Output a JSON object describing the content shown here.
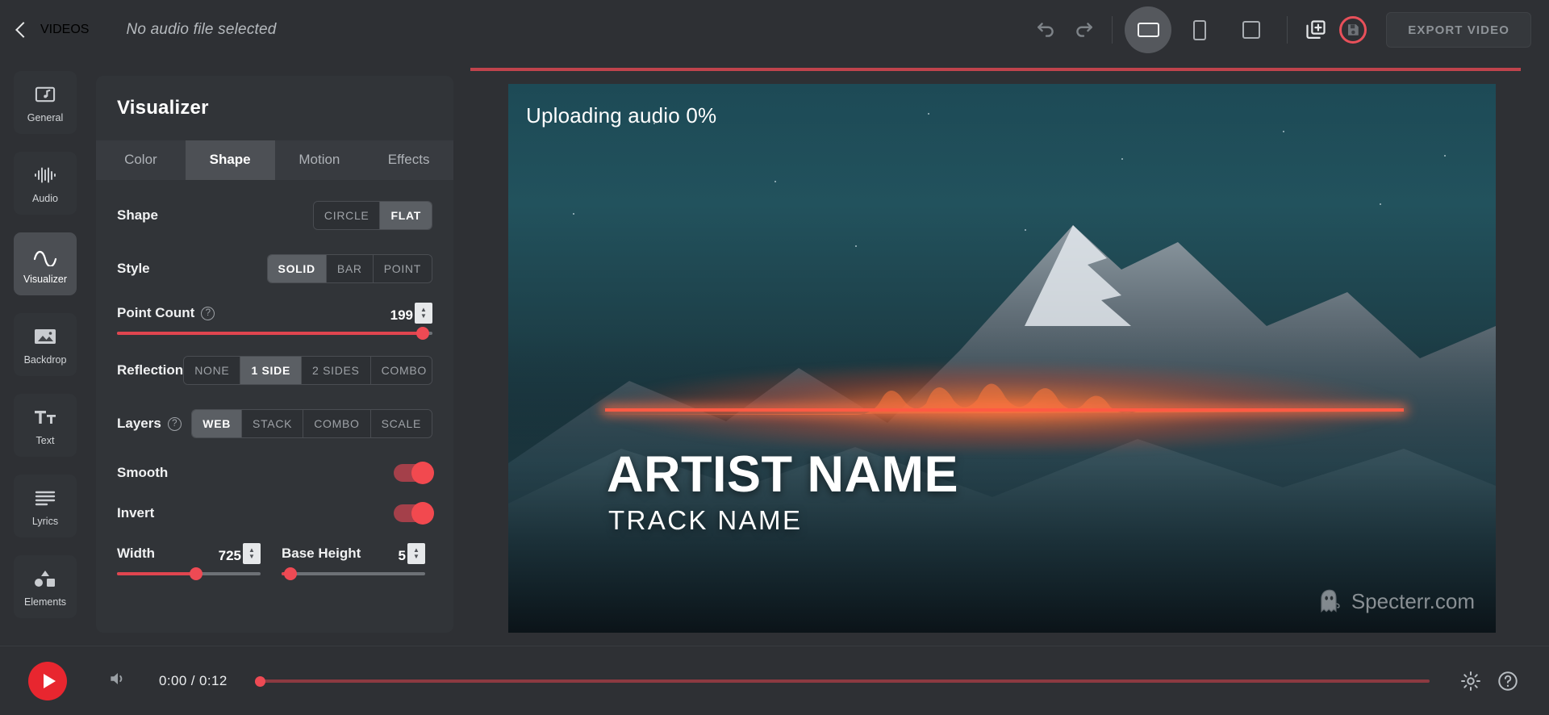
{
  "topbar": {
    "back_label": "VIDEOS",
    "audio_status": "No audio file selected",
    "undo_icon": "undo-icon",
    "redo_icon": "redo-icon",
    "ratios": [
      {
        "name": "landscape",
        "selected": true
      },
      {
        "name": "portrait",
        "selected": false
      },
      {
        "name": "square",
        "selected": false
      }
    ],
    "add_scene_icon": "add-scene-icon",
    "record_icon": "record-icon",
    "export_label": "EXPORT VIDEO"
  },
  "sidebar": {
    "items": [
      {
        "label": "General",
        "icon": "general-icon",
        "active": false
      },
      {
        "label": "Audio",
        "icon": "audio-waveform-icon",
        "active": false
      },
      {
        "label": "Visualizer",
        "icon": "sine-wave-icon",
        "active": true
      },
      {
        "label": "Backdrop",
        "icon": "image-icon",
        "active": false
      },
      {
        "label": "Text",
        "icon": "text-icon",
        "active": false
      },
      {
        "label": "Lyrics",
        "icon": "lyrics-lines-icon",
        "active": false
      },
      {
        "label": "Elements",
        "icon": "elements-icon",
        "active": false
      }
    ]
  },
  "panel": {
    "title": "Visualizer",
    "tabs": [
      {
        "label": "Color",
        "active": false
      },
      {
        "label": "Shape",
        "active": true
      },
      {
        "label": "Motion",
        "active": false
      },
      {
        "label": "Effects",
        "active": false
      }
    ],
    "shape": {
      "label": "Shape",
      "options": [
        {
          "label": "CIRCLE",
          "active": false
        },
        {
          "label": "FLAT",
          "active": true
        }
      ]
    },
    "style": {
      "label": "Style",
      "options": [
        {
          "label": "SOLID",
          "active": true
        },
        {
          "label": "BAR",
          "active": false
        },
        {
          "label": "POINT",
          "active": false
        }
      ]
    },
    "point_count": {
      "label": "Point Count",
      "help": "?",
      "value": "199",
      "percent": 97
    },
    "reflection": {
      "label": "Reflection",
      "options": [
        {
          "label": "NONE",
          "active": false
        },
        {
          "label": "1 SIDE",
          "active": true
        },
        {
          "label": "2 SIDES",
          "active": false
        },
        {
          "label": "COMBO",
          "active": false
        }
      ]
    },
    "layers": {
      "label": "Layers",
      "help": "?",
      "options": [
        {
          "label": "WEB",
          "active": true
        },
        {
          "label": "STACK",
          "active": false
        },
        {
          "label": "COMBO",
          "active": false
        },
        {
          "label": "SCALE",
          "active": false
        }
      ]
    },
    "smooth": {
      "label": "Smooth",
      "on": true
    },
    "invert": {
      "label": "Invert",
      "on": true
    },
    "width": {
      "label": "Width",
      "value": "725",
      "percent": 55
    },
    "base_height": {
      "label": "Base Height",
      "value": "5",
      "percent": 6
    }
  },
  "preview": {
    "uploading_text": "Uploading audio 0%",
    "progress_percent": 100,
    "artist_name": "ARTIST NAME",
    "track_name": "TRACK NAME",
    "watermark_text": "Specterr.com",
    "watermark_icon": "ghost-icon"
  },
  "player": {
    "play_icon": "play-icon",
    "volume_icon": "volume-icon",
    "time_display": "0:00 / 0:12",
    "scrub_percent": 0,
    "settings_icon": "gear-icon",
    "help_icon": "question-circle-icon"
  },
  "colors": {
    "accent_red": "#ee4a54",
    "panel_bg": "#313438",
    "app_bg": "#2e3034",
    "active_seg": "#5b5f64"
  }
}
